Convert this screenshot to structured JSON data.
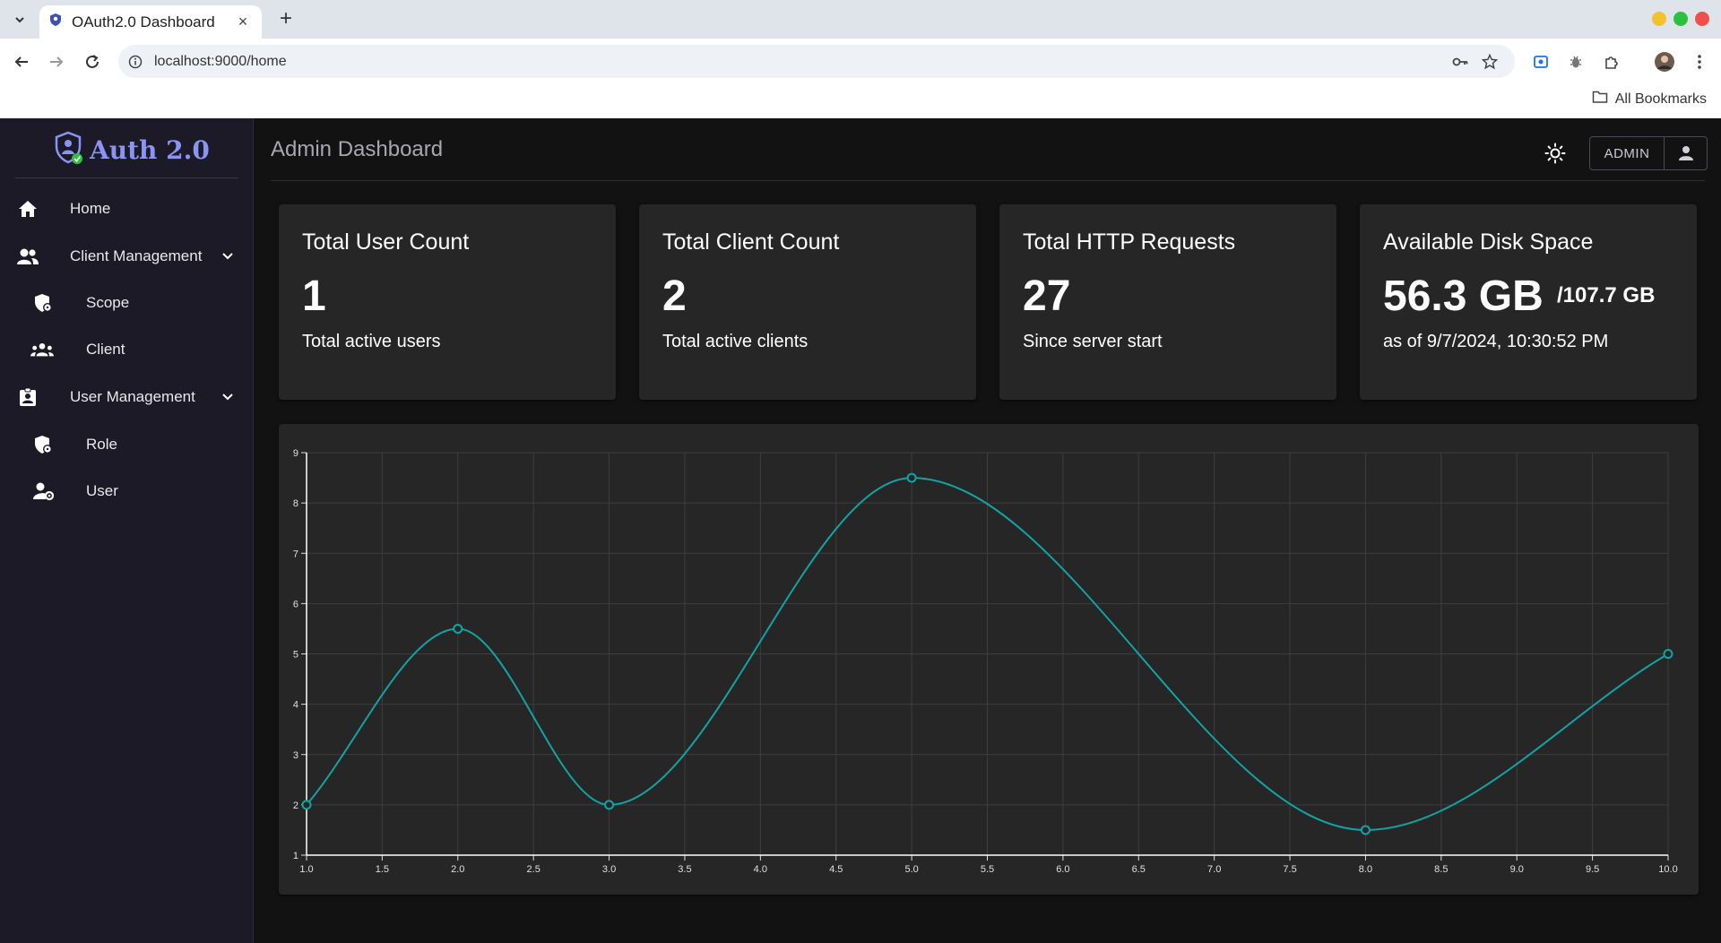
{
  "browser": {
    "tab_title": "OAuth2.0 Dashboard",
    "url": "localhost:9000/home",
    "bookmarks_label": "All Bookmarks",
    "new_tab": "+",
    "close": "×"
  },
  "sidebar": {
    "logo_text": "Auth 2.0",
    "items": [
      {
        "label": "Home",
        "icon": "home-icon"
      },
      {
        "label": "Client Management",
        "icon": "people-icon",
        "expandable": true
      },
      {
        "label": "Scope",
        "icon": "shield-icon"
      },
      {
        "label": "Client",
        "icon": "groups-icon"
      },
      {
        "label": "User Management",
        "icon": "badge-icon",
        "expandable": true
      },
      {
        "label": "Role",
        "icon": "shield-icon"
      },
      {
        "label": "User",
        "icon": "user-gear-icon"
      }
    ]
  },
  "header": {
    "title": "Admin Dashboard",
    "admin_label": "ADMIN"
  },
  "cards": [
    {
      "title": "Total User Count",
      "value": "1",
      "subtitle": "Total active users"
    },
    {
      "title": "Total Client Count",
      "value": "2",
      "subtitle": "Total active clients"
    },
    {
      "title": "Total HTTP Requests",
      "value": "27",
      "subtitle": "Since server start"
    },
    {
      "title": "Available Disk Space",
      "value": "56.3 GB",
      "total": "/107.7 GB",
      "subtitle": "as of 9/7/2024, 10:30:52 PM"
    }
  ],
  "colors": {
    "accent": "#8b93f5",
    "line": "#13a3a3",
    "sidebar_bg": "#1b1a26",
    "card_bg": "#262626"
  },
  "chart_data": {
    "type": "line",
    "x": [
      1,
      2,
      3,
      5,
      8,
      10
    ],
    "y": [
      2,
      5.5,
      2,
      8.5,
      1.5,
      5
    ],
    "xlim": [
      1,
      10
    ],
    "ylim": [
      1,
      9
    ],
    "x_ticks": [
      "1.0",
      "1.5",
      "2.0",
      "2.5",
      "3.0",
      "3.5",
      "4.0",
      "4.5",
      "5.0",
      "5.5",
      "6.0",
      "6.5",
      "7.0",
      "7.5",
      "8.0",
      "8.5",
      "9.0",
      "9.5",
      "10.0"
    ],
    "y_ticks": [
      "1",
      "2",
      "3",
      "4",
      "5",
      "6",
      "7",
      "8",
      "9"
    ],
    "grid": true,
    "curve": "smooth"
  }
}
